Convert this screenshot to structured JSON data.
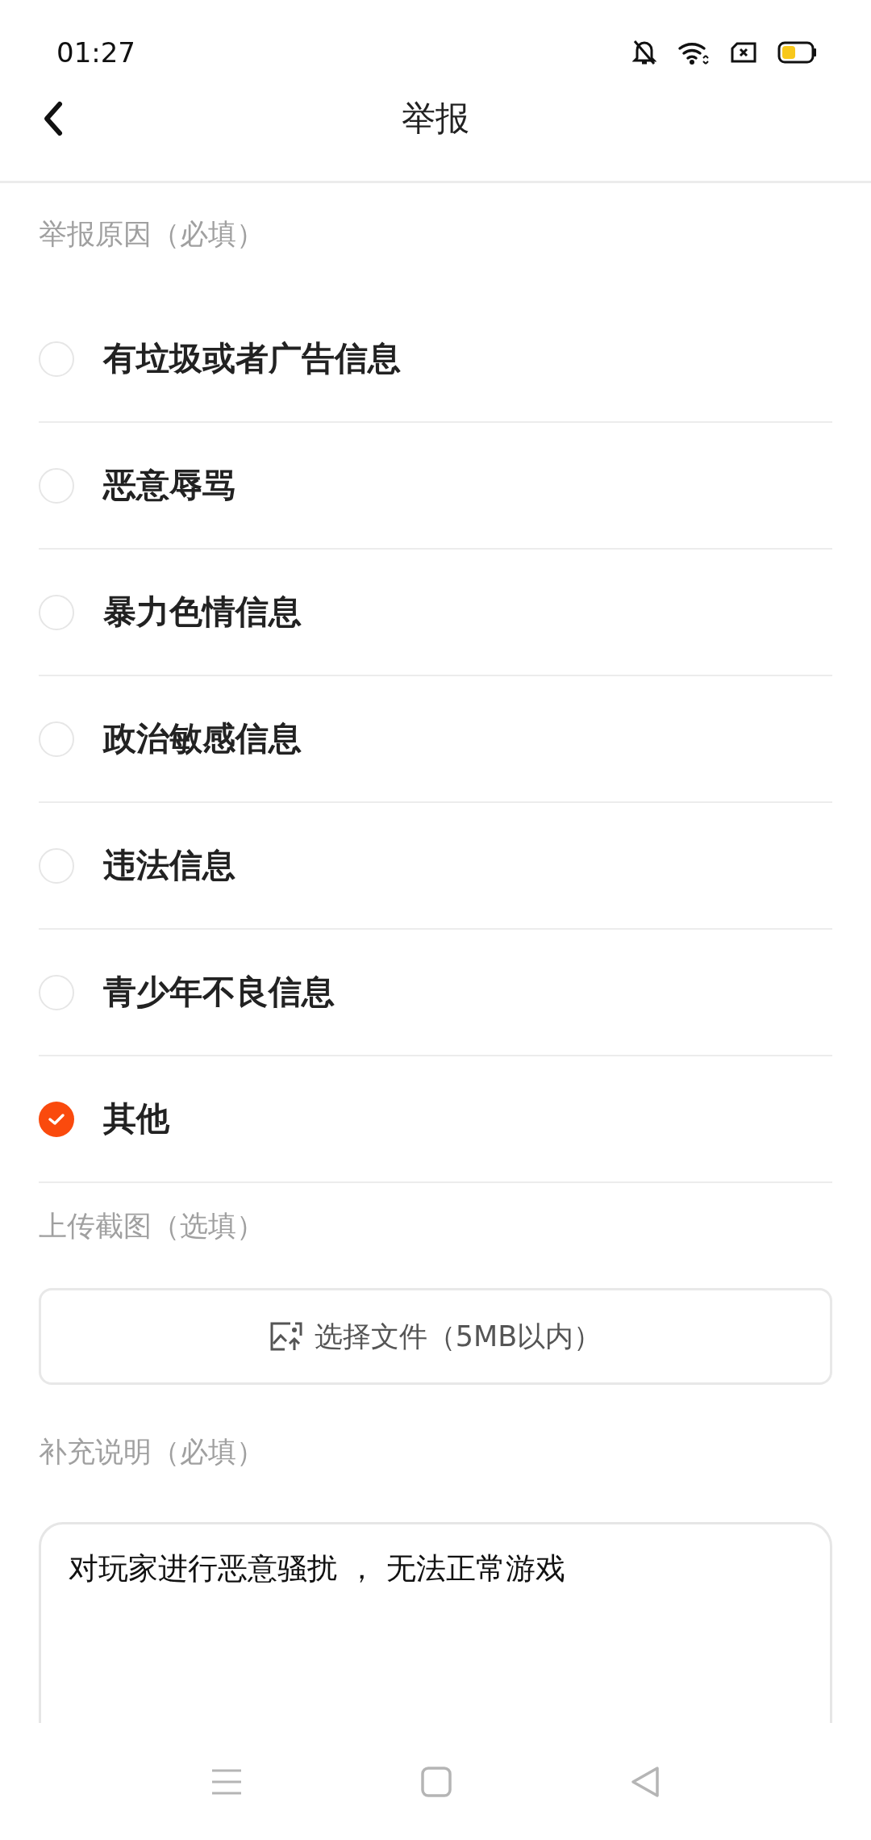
{
  "status_bar": {
    "time": "01:27"
  },
  "header": {
    "title": "举报"
  },
  "reasons": {
    "label": "举报原因（必填）",
    "options": [
      {
        "label": "有垃圾或者广告信息",
        "selected": false
      },
      {
        "label": "恶意辱骂",
        "selected": false
      },
      {
        "label": "暴力色情信息",
        "selected": false
      },
      {
        "label": "政治敏感信息",
        "selected": false
      },
      {
        "label": "违法信息",
        "selected": false
      },
      {
        "label": "青少年不良信息",
        "selected": false
      },
      {
        "label": "其他",
        "selected": true
      }
    ]
  },
  "upload": {
    "label": "上传截图（选填）",
    "button": "选择文件（5MB以内）"
  },
  "description": {
    "label": "补充说明（必填）",
    "value": "对玩家进行恶意骚扰 ， 无法正常游戏"
  }
}
